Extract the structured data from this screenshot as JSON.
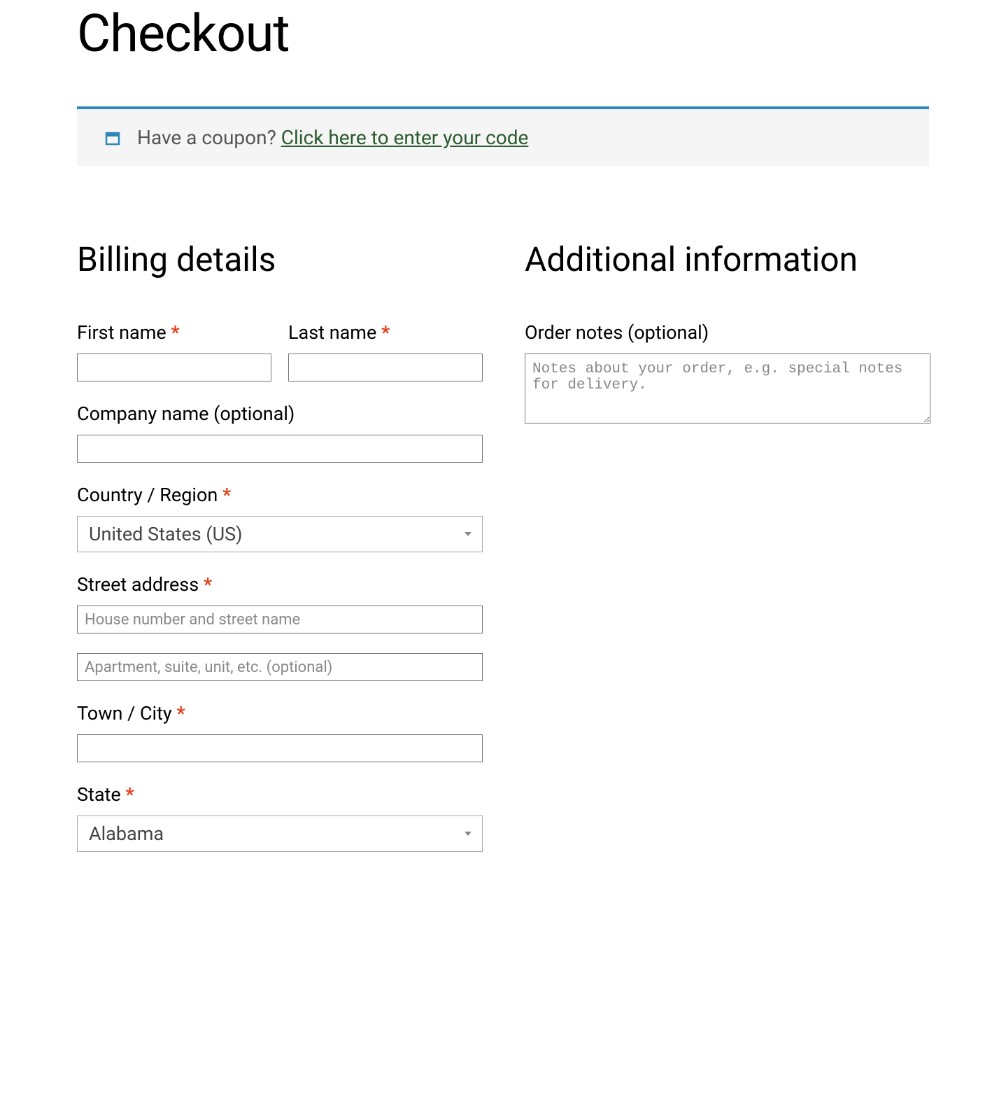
{
  "page": {
    "title": "Checkout"
  },
  "coupon": {
    "prompt": "Have a coupon? ",
    "link_text": "Click here to enter your code"
  },
  "billing": {
    "heading": "Billing details",
    "first_name": {
      "label": "First name ",
      "value": ""
    },
    "last_name": {
      "label": "Last name ",
      "value": ""
    },
    "company": {
      "label": "Company name (optional)",
      "value": ""
    },
    "country": {
      "label": "Country / Region ",
      "selected": "United States (US)"
    },
    "street": {
      "label": "Street address ",
      "line1_placeholder": "House number and street name",
      "line1_value": "",
      "line2_placeholder": "Apartment, suite, unit, etc. (optional)",
      "line2_value": ""
    },
    "city": {
      "label": "Town / City ",
      "value": ""
    },
    "state": {
      "label": "State ",
      "selected": "Alabama"
    }
  },
  "additional": {
    "heading": "Additional information",
    "order_notes": {
      "label": "Order notes (optional)",
      "placeholder": "Notes about your order, e.g. special notes for delivery.",
      "value": ""
    }
  },
  "required_mark": "*"
}
